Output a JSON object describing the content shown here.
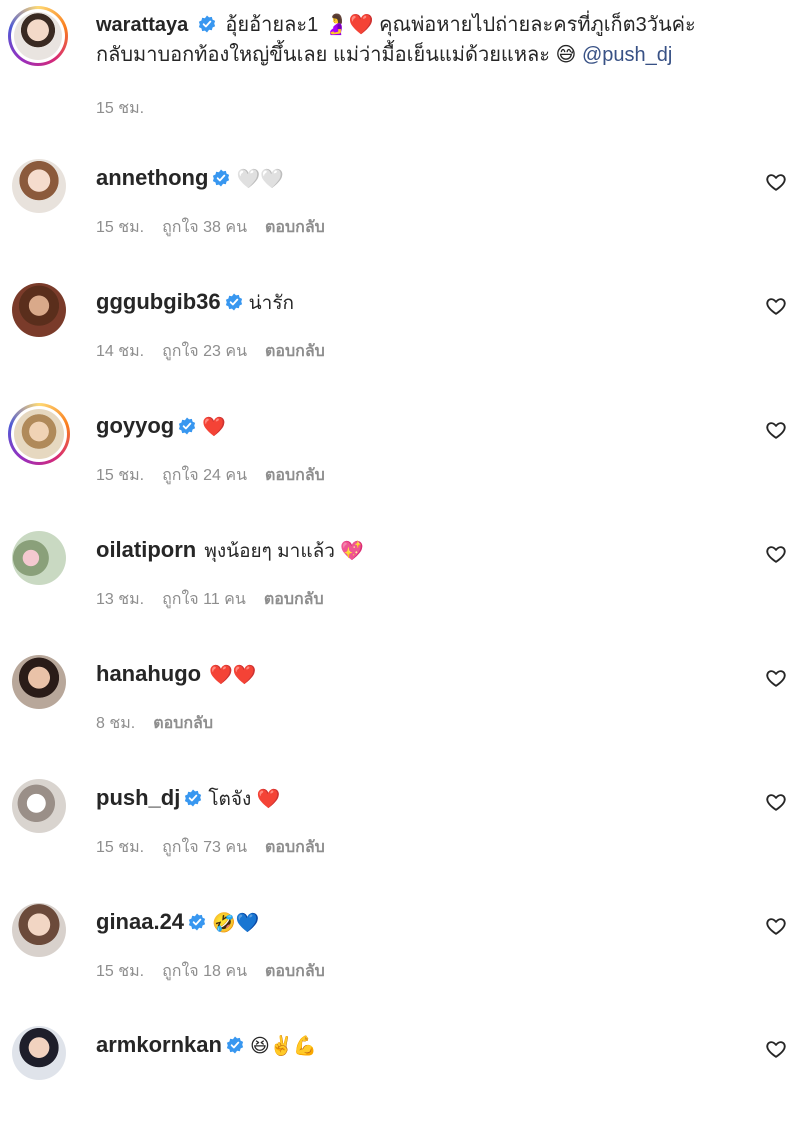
{
  "caption": {
    "username": "warattaya",
    "text_line1": "อุ้ยอ้ายละ1 🤰❤️ คุณพ่อหายไปถ่ายละครที่ภูเก็ต3วันค่ะ",
    "text_line2": "กลับมาบอกท้องใหญ่ขึ้นเลย แม่ว่ามื้อเย็นแม่ด้วยแหละ 😅",
    "mention": "@push_dj",
    "time": "15 ชม."
  },
  "labels": {
    "likes_prefix": "ถูกใจ",
    "likes_suffix": "คน",
    "reply": "ตอบกลับ"
  },
  "comments": [
    {
      "username": "annethong",
      "text": "🤍🤍",
      "time": "15 ชม.",
      "likes": "38",
      "verified": true
    },
    {
      "username": "gggubgib36",
      "text": "น่ารัก",
      "time": "14 ชม.",
      "likes": "23",
      "verified": true
    },
    {
      "username": "goyyog",
      "text": "❤️",
      "time": "15 ชม.",
      "likes": "24",
      "verified": true
    },
    {
      "username": "oilatiporn",
      "text": "พุงน้อยๆ มาแล้ว 💖",
      "time": "13 ชม.",
      "likes": "11",
      "verified": false
    },
    {
      "username": "hanahugo",
      "text": "❤️❤️",
      "time": "8 ชม.",
      "likes": "",
      "verified": false
    },
    {
      "username": "push_dj",
      "text": "โตจัง ❤️",
      "time": "15 ชม.",
      "likes": "73",
      "verified": true
    },
    {
      "username": "ginaa.24",
      "text": "🤣💙",
      "time": "15 ชม.",
      "likes": "18",
      "verified": true
    },
    {
      "username": "armkornkan",
      "text": "😆✌️💪",
      "time": "",
      "likes": "",
      "verified": true
    }
  ],
  "colors": {
    "verified_blue": "#3897f0",
    "meta_gray": "#8e8e8e",
    "mention_blue": "#385185"
  },
  "icons": {
    "verified": "verified-badge-icon",
    "like": "heart-outline-icon"
  }
}
